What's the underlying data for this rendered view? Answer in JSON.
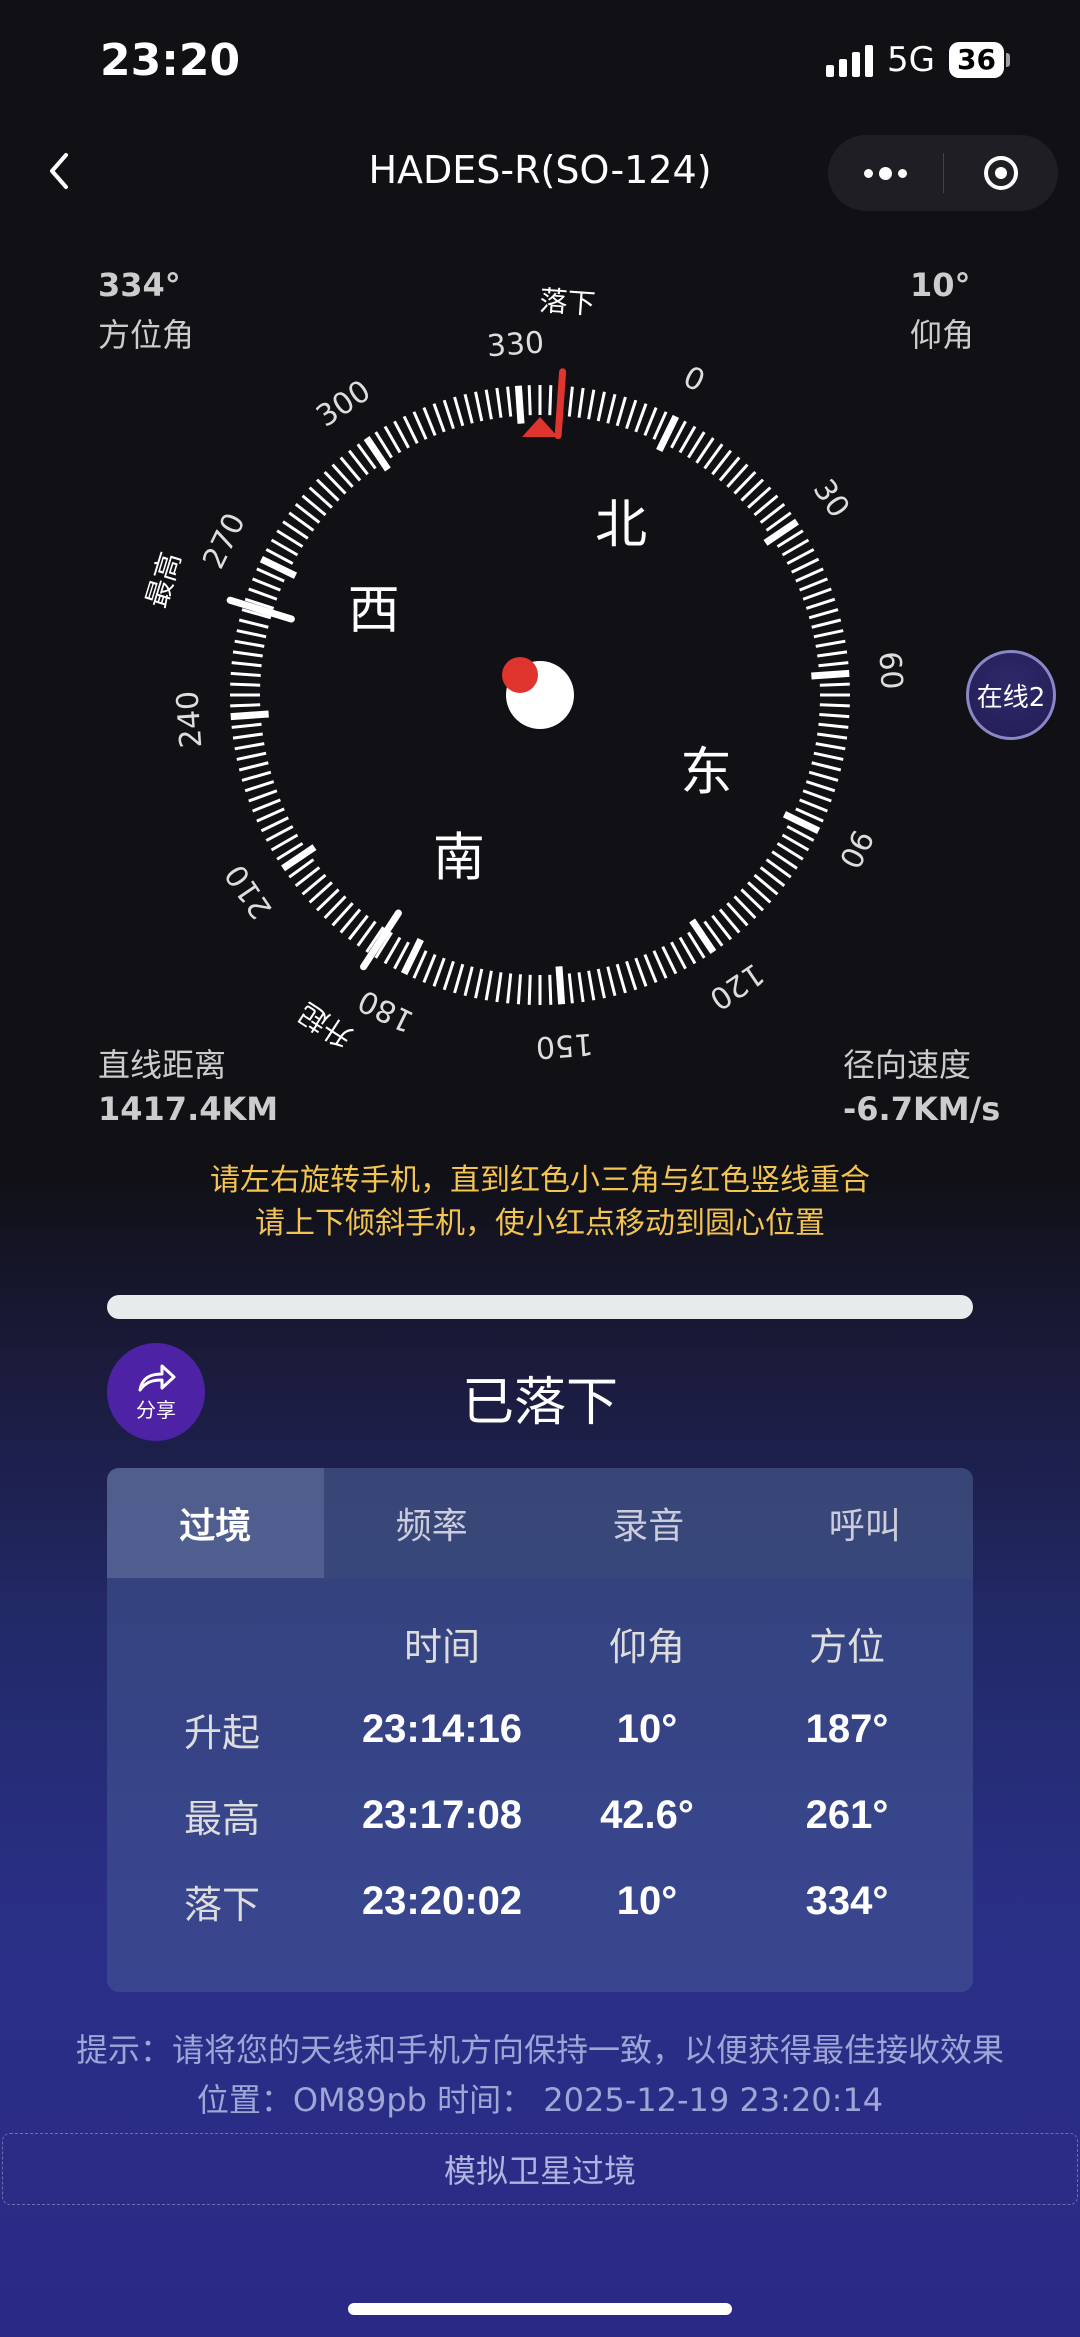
{
  "status_bar": {
    "time": "23:20",
    "network": "5G",
    "battery": "36"
  },
  "nav": {
    "back_icon": "chevron-left-icon",
    "title": "HADES-R(SO-124)"
  },
  "azimuth": {
    "value": "334°",
    "label": "方位角"
  },
  "elevation": {
    "value": "10°",
    "label": "仰角"
  },
  "distance": {
    "label": "直线距离",
    "value": "1417.4KM"
  },
  "radial_speed": {
    "label": "径向速度",
    "value": "-6.7KM/s"
  },
  "compass": {
    "heading_deg": 334,
    "rise_azimuth": 187,
    "max_azimuth": 261,
    "set_azimuth": 334,
    "marker_labels": {
      "set": "落下",
      "max": "最高",
      "rise": "升起"
    },
    "degree_labels": [
      {
        "deg": 0,
        "text": "0"
      },
      {
        "deg": 30,
        "text": "30"
      },
      {
        "deg": 60,
        "text": "60"
      },
      {
        "deg": 90,
        "text": "90"
      },
      {
        "deg": 120,
        "text": "120"
      },
      {
        "deg": 150,
        "text": "150"
      },
      {
        "deg": 180,
        "text": "180"
      },
      {
        "deg": 210,
        "text": "210"
      },
      {
        "deg": 240,
        "text": "240"
      },
      {
        "deg": 270,
        "text": "270"
      },
      {
        "deg": 300,
        "text": "300"
      },
      {
        "deg": 330,
        "text": "330"
      }
    ],
    "directions": [
      {
        "deg": 0,
        "text": "北"
      },
      {
        "deg": 90,
        "text": "东"
      },
      {
        "deg": 180,
        "text": "南"
      },
      {
        "deg": 270,
        "text": "西"
      }
    ]
  },
  "online_badge": "在线2",
  "hints": [
    "请左右旋转手机，直到红色小三角与红色竖线重合",
    "请上下倾斜手机，使小红点移动到圆心位置"
  ],
  "share": {
    "label": "分享",
    "icon": "share-arrow-icon"
  },
  "pass_status": "已落下",
  "tabs": [
    {
      "label": "过境",
      "active": true
    },
    {
      "label": "频率",
      "active": false
    },
    {
      "label": "录音",
      "active": false
    },
    {
      "label": "呼叫",
      "active": false
    }
  ],
  "table": {
    "headers": [
      "",
      "时间",
      "仰角",
      "方位"
    ],
    "rows": [
      [
        "升起",
        "23:14:16",
        "10°",
        "187°"
      ],
      [
        "最高",
        "23:17:08",
        "42.6°",
        "261°"
      ],
      [
        "落下",
        "23:20:02",
        "10°",
        "334°"
      ]
    ]
  },
  "footer": {
    "tip": "提示：请将您的天线和手机方向保持一致，以便获得最佳接收效果",
    "location_line": "位置：OM89pb 时间： 2025-12-19 23:20:14",
    "simulate_button": "模拟卫星过境"
  }
}
